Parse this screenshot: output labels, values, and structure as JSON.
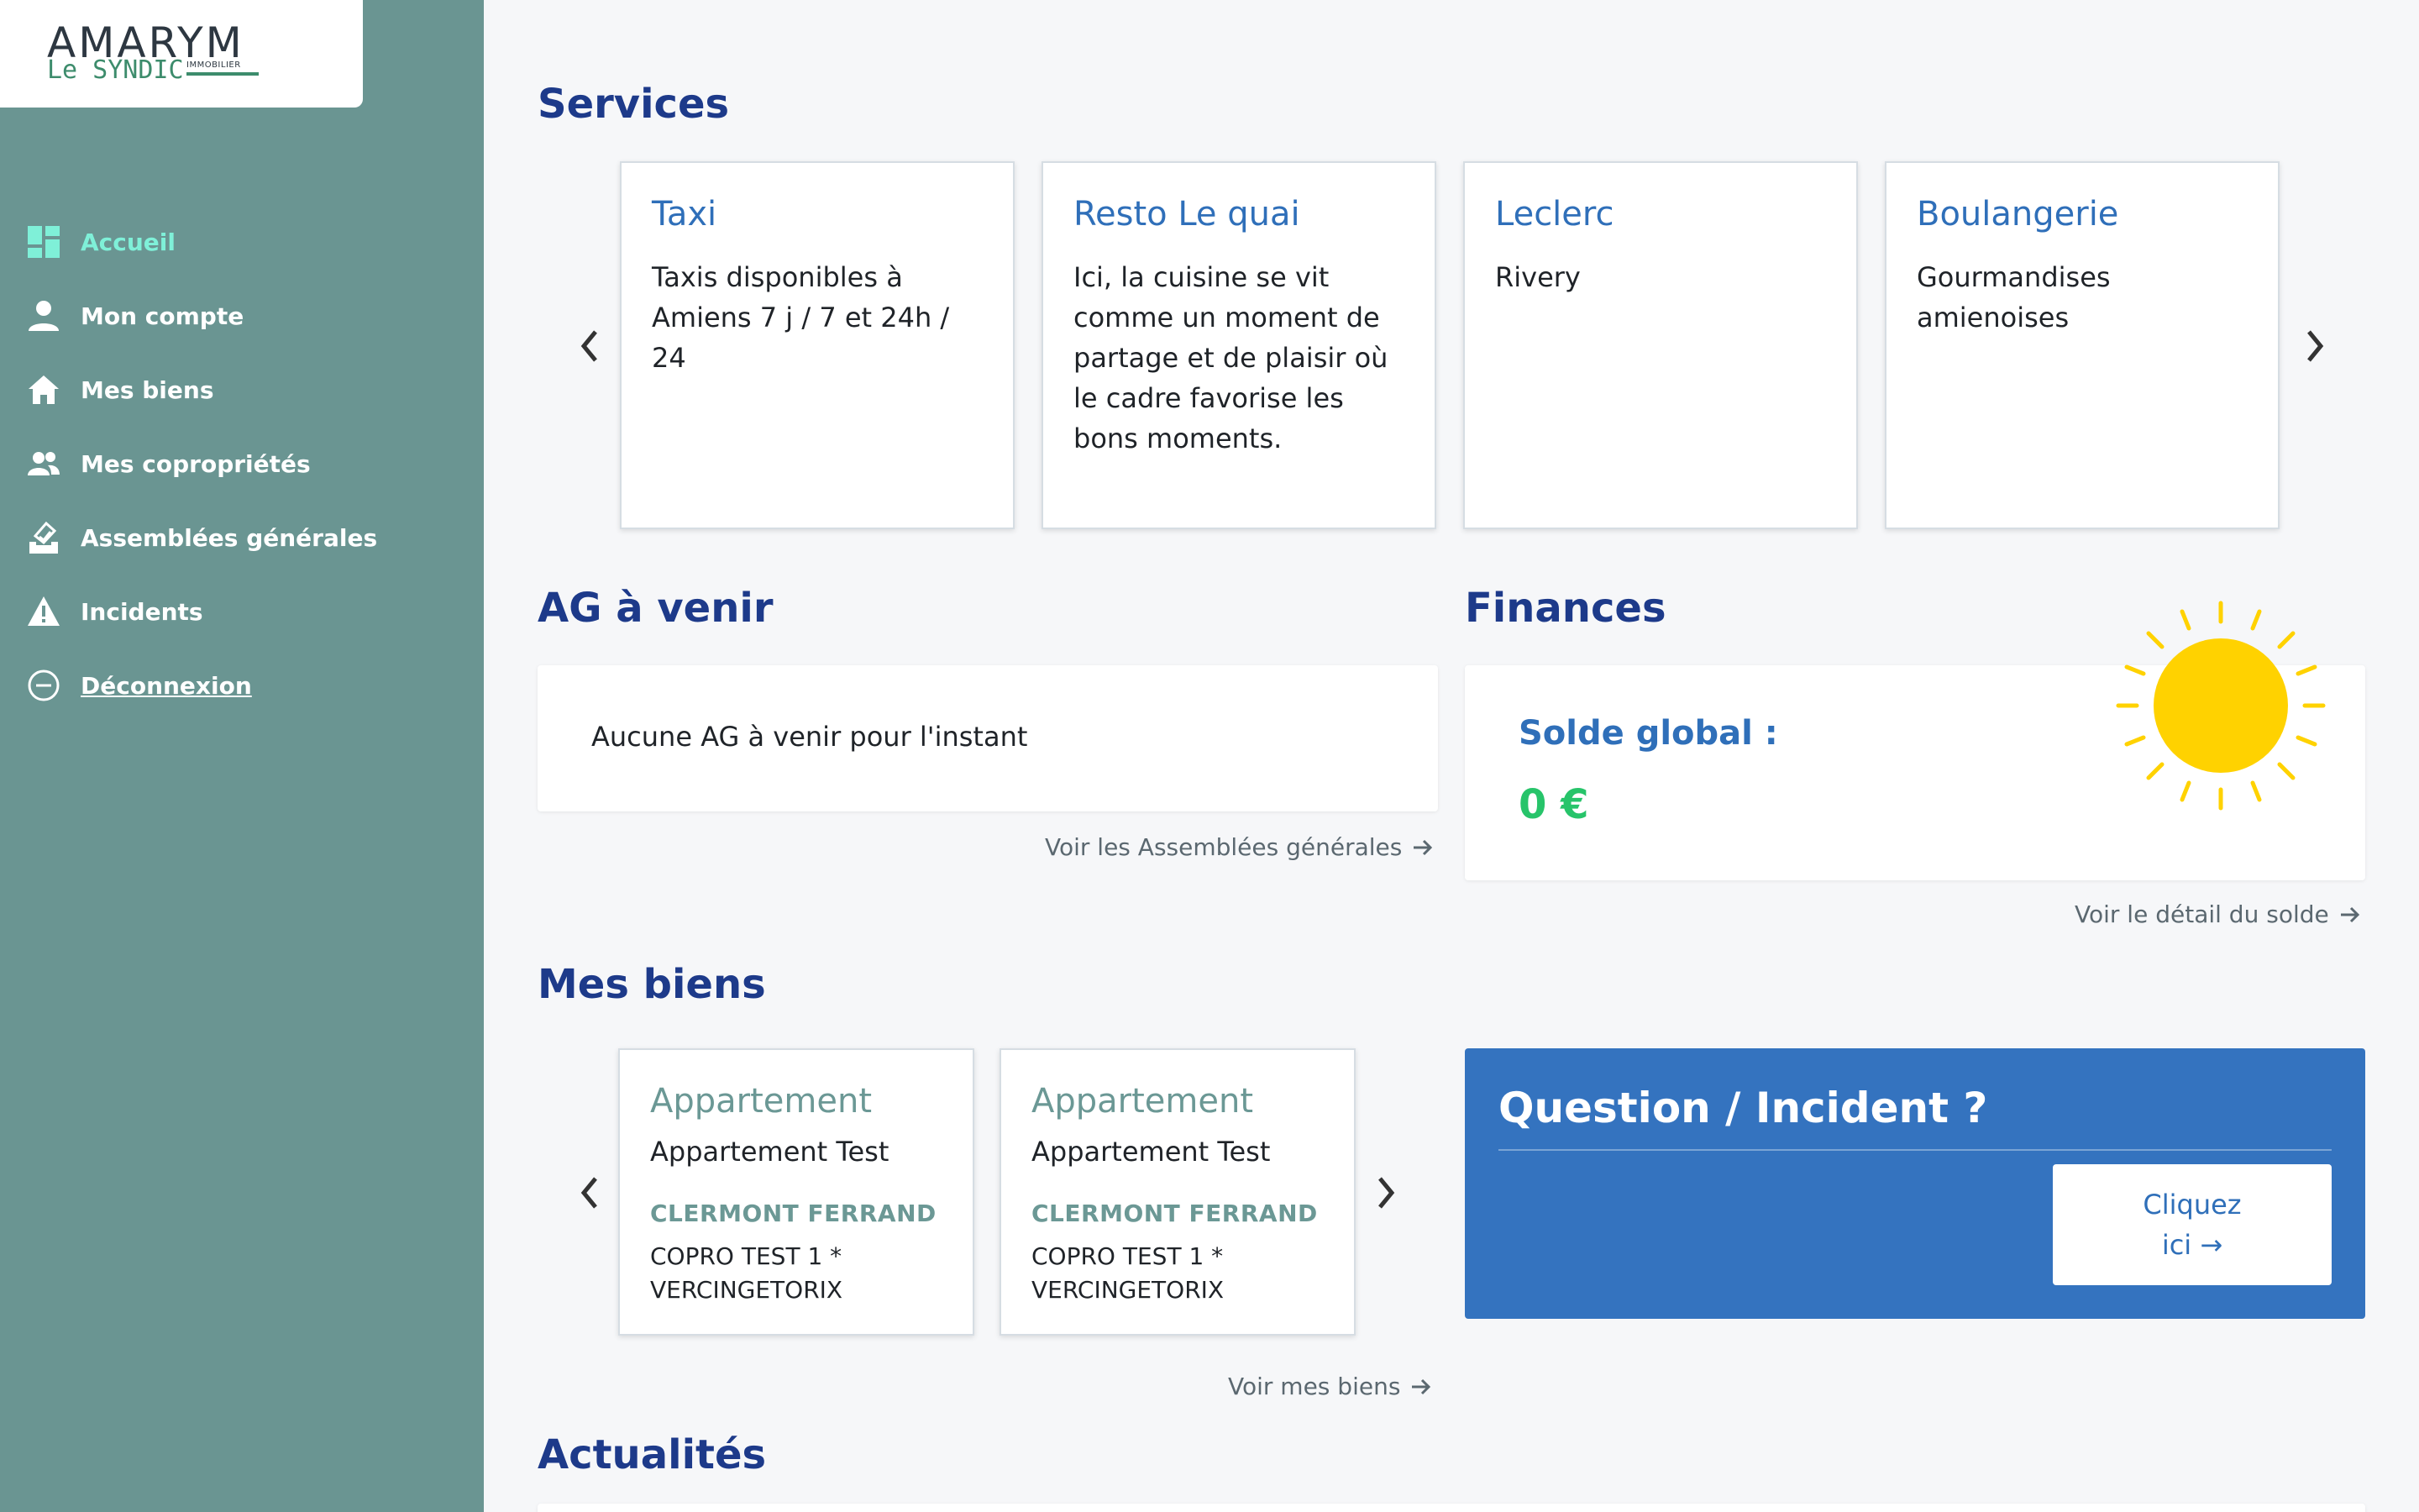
{
  "logo": {
    "brand": "AMARYM",
    "sub": "Le SYNDIC",
    "tag": "IMMOBILIER"
  },
  "nav": {
    "items": [
      {
        "label": "Accueil"
      },
      {
        "label": "Mon compte"
      },
      {
        "label": "Mes biens"
      },
      {
        "label": "Mes copropriétés"
      },
      {
        "label": "Assemblées générales"
      },
      {
        "label": "Incidents"
      },
      {
        "label": "Déconnexion"
      }
    ]
  },
  "services": {
    "title": "Services",
    "cards": [
      {
        "title": "Taxi",
        "desc": "Taxis disponibles à Amiens 7 j / 7 et 24h / 24"
      },
      {
        "title": "Resto Le quai",
        "desc": "Ici, la cuisine se vit comme un moment de partage et de plaisir où le cadre favorise les bons moments."
      },
      {
        "title": "Leclerc",
        "desc": "Rivery"
      },
      {
        "title": "Boulangerie",
        "desc": "Gourmandises amienoises"
      }
    ]
  },
  "ag": {
    "title": "AG à venir",
    "empty": "Aucune AG à venir pour l'instant",
    "link": "Voir les Assemblées générales"
  },
  "finances": {
    "title": "Finances",
    "solde_label": "Solde global :",
    "solde_value": "0 €",
    "link": "Voir le détail du solde"
  },
  "biens": {
    "title": "Mes biens",
    "cards": [
      {
        "type": "Appartement",
        "name": "Appartement Test",
        "city": "CLERMONT FERRAND",
        "copro": "COPRO TEST 1 * VERCINGETORIX"
      },
      {
        "type": "Appartement",
        "name": "Appartement Test",
        "city": "CLERMONT FERRAND",
        "copro": "COPRO TEST 1 * VERCINGETORIX"
      }
    ],
    "link": "Voir mes biens"
  },
  "incident": {
    "title": "Question / Incident ?",
    "button_line1": "Cliquez",
    "button_line2": "ici →"
  },
  "actualites": {
    "title": "Actualités"
  },
  "colors": {
    "sidebar": "#6a9592",
    "accent_title": "#1d3a8a",
    "link_blue": "#2f6fb9",
    "positive": "#27c46a",
    "incident_bg": "#3473bf",
    "sun": "#ffd200"
  }
}
